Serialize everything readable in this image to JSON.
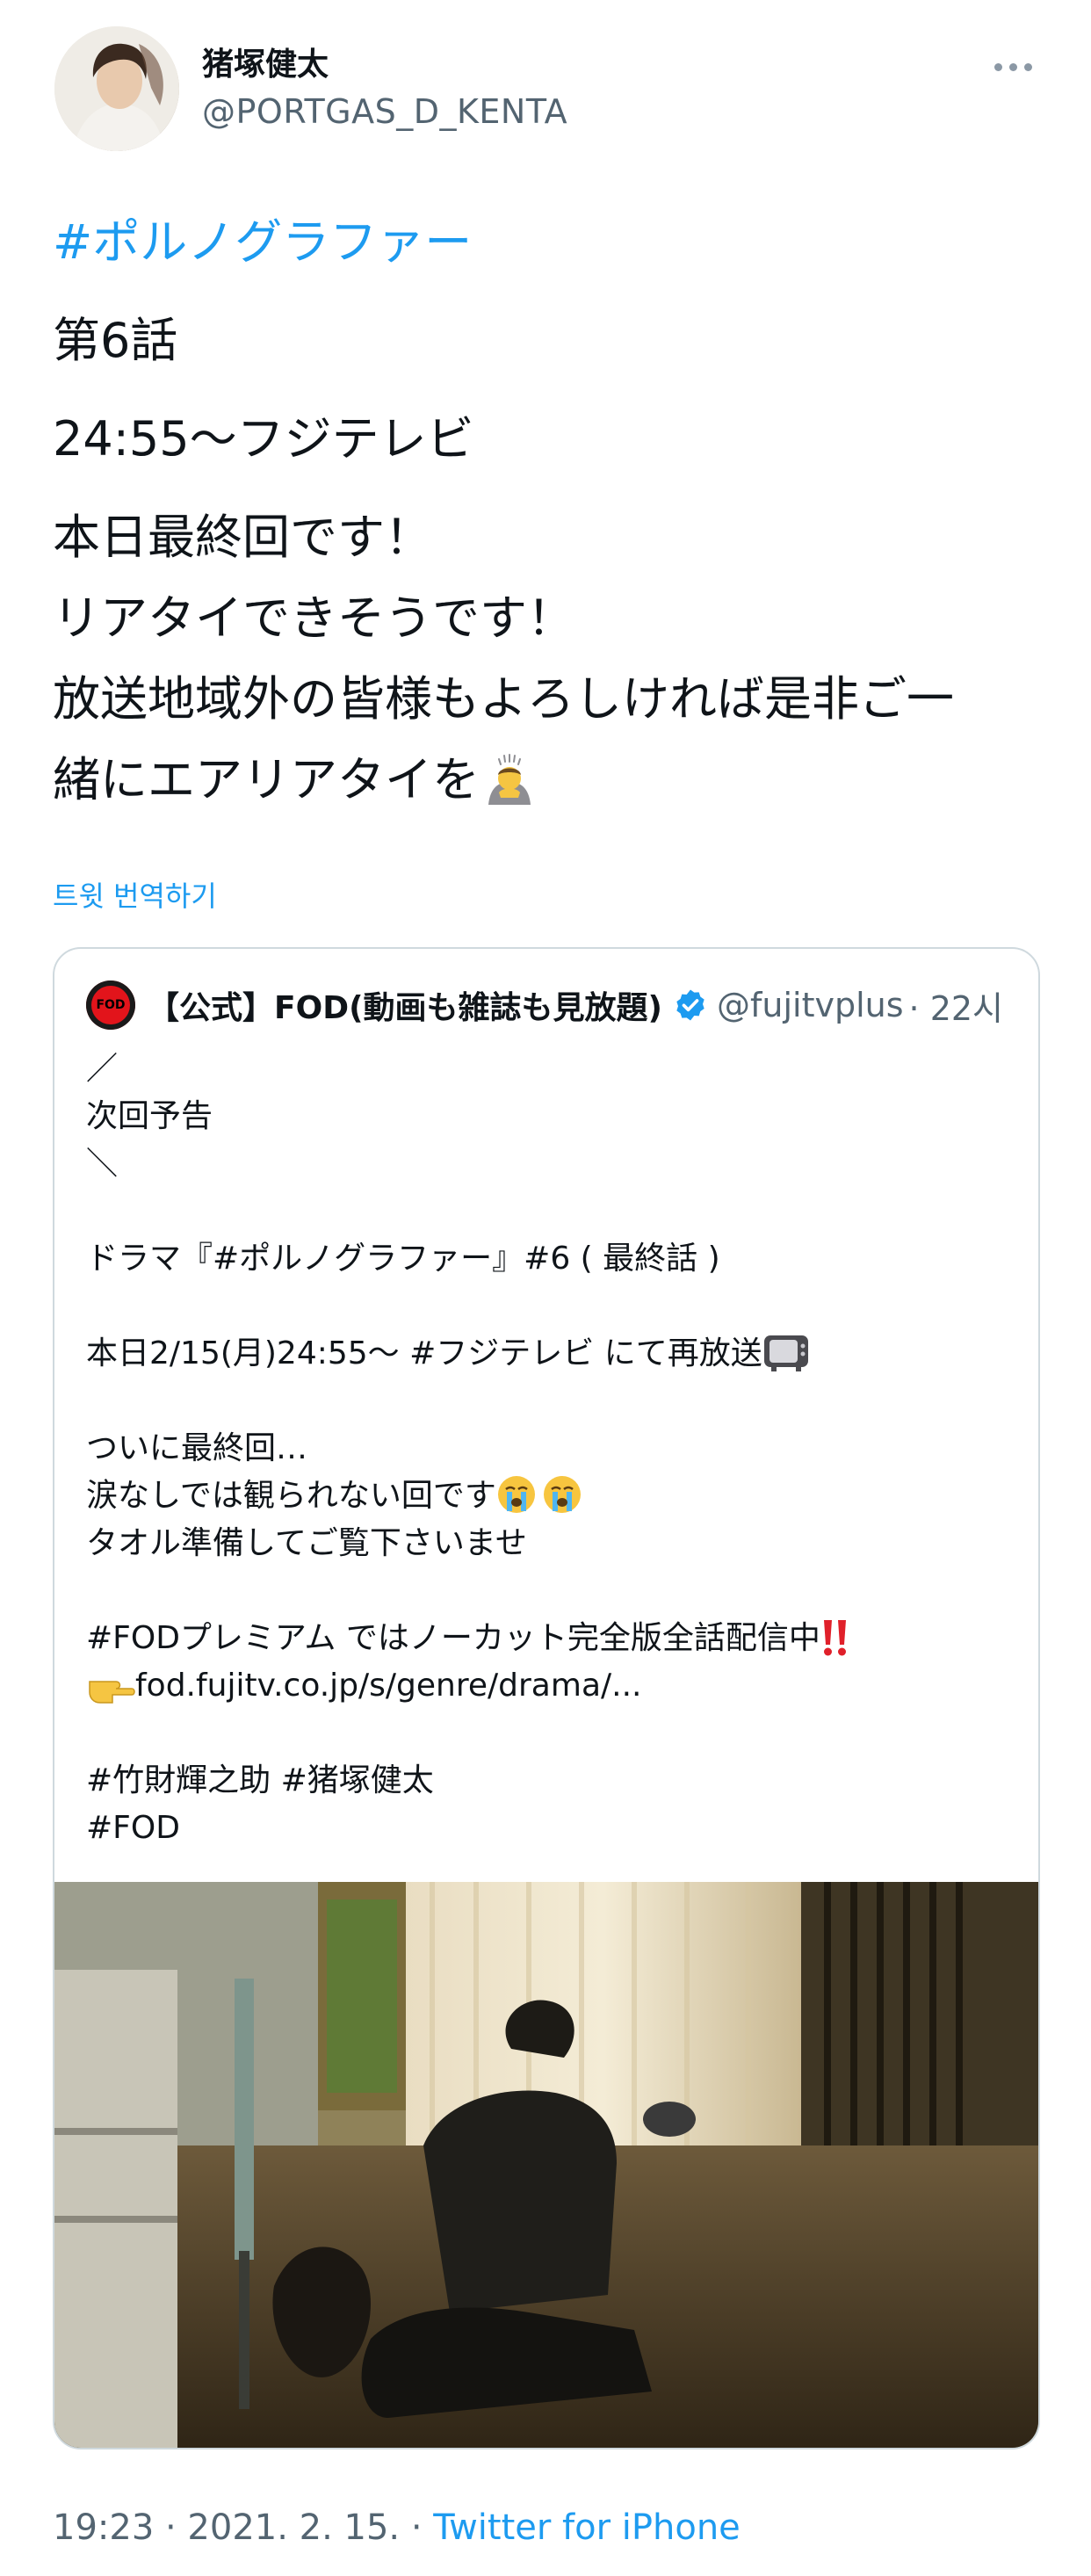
{
  "author": {
    "name": "猪塚健太",
    "handle": "@PORTGAS_D_KENTA"
  },
  "tweet": {
    "hashtag": "#ポルノグラファー",
    "line_episode": "第6話",
    "line_time": "24:55～フジテレビ",
    "line_1": "本日最終回です！",
    "line_2": "リアタイできそうです！",
    "line_3": "放送地域外の皆様もよろしければ是非ご一",
    "line_4": "緒にエアリアタイを",
    "emoji": "person-bowing-emoji"
  },
  "translate_label": "트윗 번역하기",
  "quoted": {
    "logo_text": "FOD",
    "name": "【公式】FOD(動画も雑誌も見放題)",
    "handle": "@fujitvplus",
    "time": "· 22시",
    "lines": {
      "l1": "／",
      "l2": "次回予告",
      "l3": "＼",
      "l4": "ドラマ『#ポルノグラファー』#6 ( 最終話 )",
      "l5": "本日2/15(月)24:55～ #フジテレビ にて再放送",
      "l6": "ついに最終回…",
      "l7": "涙なしでは観られない回です",
      "l8": "タオル準備してご覧下さいませ",
      "l9": "#FODプレミアム ではノーカット完全版全話配信中",
      "l10": "fod.fujitv.co.jp/s/genre/drama/...",
      "l11": "#竹財輝之助 #猪塚健太",
      "l12": "#FOD"
    },
    "icons": [
      "tv-emoji",
      "crying-face-emoji",
      "crying-face-emoji",
      "double-exclamation-emoji",
      "pointing-right-emoji"
    ]
  },
  "footer": {
    "time": "19:23 · 2021. 2. 15. · ",
    "source": "Twitter for iPhone"
  },
  "colors": {
    "link": "#1d9bf0",
    "secondary": "#536471",
    "border": "#cfd9de",
    "brand_red": "#e2141b"
  }
}
